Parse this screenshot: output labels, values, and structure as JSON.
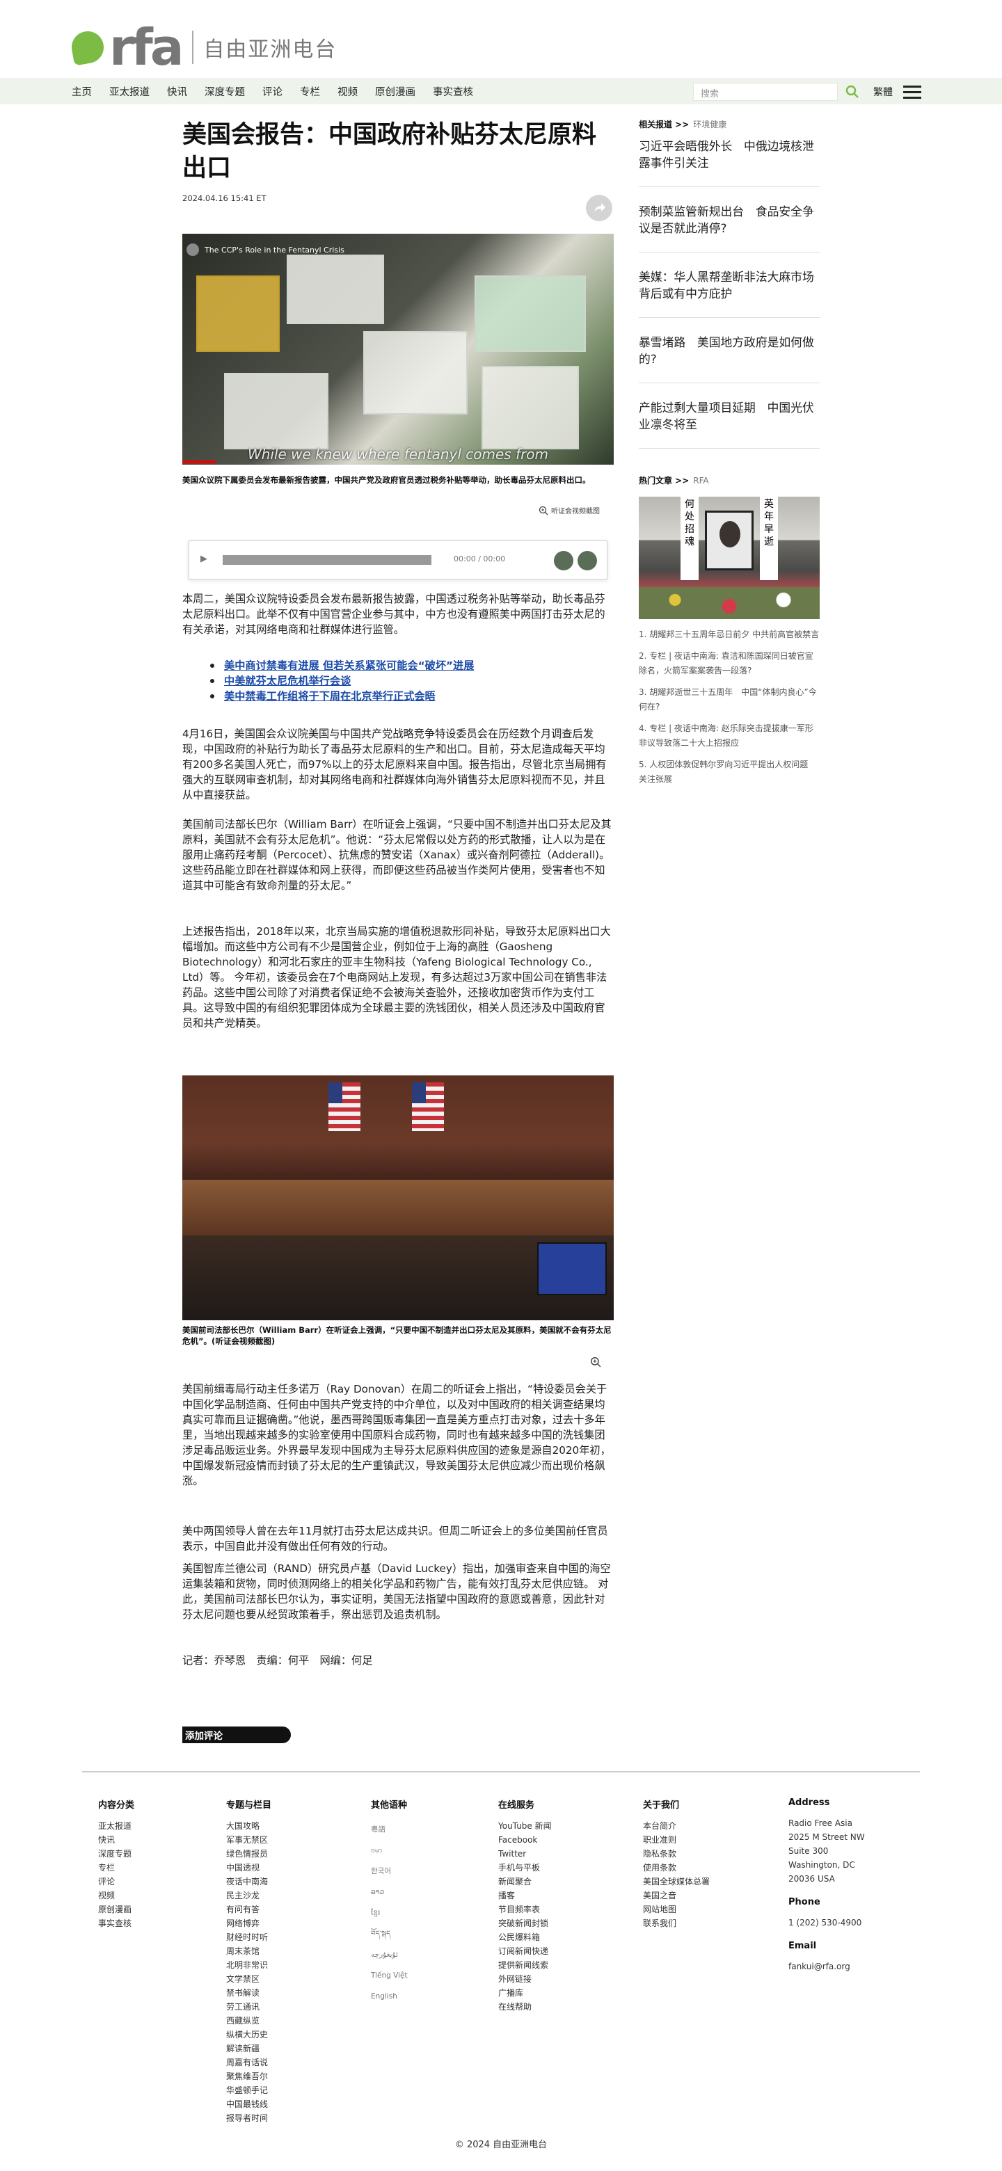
{
  "header": {
    "logo_text": "rfa",
    "logo_sub": "自由亚洲电台",
    "nav": [
      "主页",
      "亚太报道",
      "快讯",
      "深度专题",
      "评论",
      "专栏",
      "视频",
      "原创漫画",
      "事实查核"
    ],
    "search_placeholder": "搜索",
    "lang": "繁體"
  },
  "article": {
    "headline": "美国会报告：中国政府补贴芬太尼原料出口",
    "dateline": "2024.04.16 15:41 ET",
    "video_title": "The CCP's Role in the Fentanyl Crisis",
    "video_subtitle": "While we knew where fentanyl comes from",
    "caption1": "美国众议院下属委员会发布最新报告披露，中国共产党及政府官员透过税务补贴等举动，助长毒品芬太尼原料出口。",
    "enlarge_label": "听证会视频截图",
    "audio_time": "00:00 / 00:00",
    "p1": "本周二，美国众议院特设委员会发布最新报告披露，中国透过税务补贴等举动，助长毒品芬太尼原料出口。此举不仅有中国官营企业参与其中，中方也没有遵照美中两国打击芬太尼的有关承诺，对其网络电商和社群媒体进行监管。",
    "related": [
      "美中商讨禁毒有进展 但若关系紧张可能会“破坏”进展",
      "中美就芬太尼危机举行会谈",
      "美中禁毒工作组将于下周在北京举行正式会晤"
    ],
    "p2": "4月16日，美国国会众议院美国与中国共产党战略竞争特设委员会在历经数个月调查后发现，中国政府的补贴行为助长了毒品芬太尼原料的生产和出口。目前，芬太尼造成每天平均有200多名美国人死亡，而97%以上的芬太尼原料来自中国。报告指出，尽管北京当局拥有强大的互联网审查机制，却对其网络电商和社群媒体向海外销售芬太尼原料视而不见，并且从中直接获益。",
    "p3": "美国前司法部长巴尔（William Barr）在听证会上强调，“只要中国不制造并出口芬太尼及其原料，美国就不会有芬太尼危机”。他说：“芬太尼常假以处方药的形式散播，让人以为是在服用止痛药羟考酮（Percocet）、抗焦虑的赞安诺（Xanax）或兴奋剂阿德拉（Adderall)。这些药品能立即在社群媒体和网上获得，而即便这些药品被当作类阿片使用，受害者也不知道其中可能含有致命剂量的芬太尼。”",
    "p4": "上述报告指出，2018年以来，北京当局实施的增值税退款形同补贴，导致芬太尼原料出口大幅增加。而这些中方公司有不少是国营企业，例如位于上海的高胜（Gaosheng Biotechnology）和河北石家庄的亚丰生物科技（Yafeng Biological Technology Co., Ltd）等。 今年初，该委员会在7个电商网站上发现，有多达超过3万家中国公司在销售非法药品。这些中国公司除了对消费者保证绝不会被海关查验外，还接收加密货币作为支付工具。这导致中国的有组织犯罪团体成为全球最主要的洗钱团伙，相关人员还涉及中国政府官员和共产党精英。",
    "caption2": "美国前司法部长巴尔（William Barr）在听证会上强调，“只要中国不制造并出口芬太尼及其原料，美国就不会有芬太尼危机”。(听证会视频截图)",
    "p5": "美国前缉毒局行动主任多诺万（Ray Donovan）在周二的听证会上指出，“特设委员会关于中国化学品制造商、任何由中国共产党支持的中介单位，以及对中国政府的相关调查结果均真实可靠而且证据确凿。”他说，墨西哥跨国贩毒集团一直是美方重点打击对象，过去十多年里，当地出现越来越多的实验室使用中国原料合成药物，同时也有越来越多中国的洗钱集团涉足毒品贩运业务。外界最早发现中国成为主导芬太尼原料供应国的迹象是源自2020年初，中国爆发新冠疫情而封锁了芬太尼的生产重镇武汉，导致美国芬太尼供应减少而出现价格飙涨。",
    "p6": "美中两国领导人曾在去年11月就打击芬太尼达成共识。但周二听证会上的多位美国前任官员表示，中国自此并没有做出任何有效的行动。",
    "p7": "美国智库兰德公司（RAND）研究员卢基（David Luckey）指出，加强审查来自中国的海空运集装箱和货物，同时侦测网络上的相关化学品和药物广告，能有效打乱芬太尼供应链。 对此，美国前司法部长巴尔认为，事实证明，美国无法指望中国政府的意愿或善意，因此针对芬太尼问题也要从经贸政策着手，祭出惩罚及追责机制。",
    "byline": "记者：乔琴恩　责编：何平　网编：何足",
    "comment_btn": "添加评论"
  },
  "sidebar": {
    "related_head": "相关报道 >>",
    "related_sub": "环境健康",
    "related_items": [
      "习近平会晤俄外长　中俄边境核泄露事件引关注",
      "预制菜监管新规出台　食品安全争议是否就此消停?",
      "美媒：华人黑帮垄断非法大麻市场 背后或有中方庇护",
      "暴雪堵路　美国地方政府是如何做的?",
      "产能过剩大量项目延期　中国光伏业凛冬将至"
    ],
    "hot_head": "热门文章 >>",
    "hot_sub": "RFA",
    "hot_banner_left": "何处招魂",
    "hot_banner_right": "英年早逝",
    "hot_items": [
      "1. 胡耀邦三十五周年忌日前夕 中共前高官被禁言",
      "2. 专栏 | 夜话中南海: 袁洁和陈国琛同日被官宣除名，火箭军案案袭告一段落?",
      "3. 胡耀邦逝世三十五周年　中国“体制内良心”今何在?",
      "4. 专栏 | 夜话中南海: 赵乐际突击提拔康一军形非议导致落二十大上招报应",
      "5. 人权团体敦促韩尔罗向习近平提出人权问题　关注张展"
    ]
  },
  "footer": {
    "cols": [
      {
        "title": "内容分类",
        "items": [
          "亚太报道",
          "快讯",
          "深度专题",
          "专栏",
          "评论",
          "视频",
          "原创漫画",
          "事实查核"
        ]
      },
      {
        "title": "专题与栏目",
        "items": [
          "大国攻略",
          "军事无禁区",
          "绿色情报员",
          "中国透视",
          "夜话中南海",
          "民主沙龙",
          "有问有答",
          "网络博弈",
          "财经时时听",
          "周末茶馆",
          "北明非常识",
          "文学禁区",
          "禁书解读",
          "劳工通讯",
          "西藏纵览",
          "纵横大历史",
          "解读新疆",
          "周嘉有话说",
          "聚焦维吾尔",
          "华盛顿手记",
          "中国最钱线",
          "报导者时间"
        ]
      },
      {
        "title": "其他语种",
        "items": [
          "粵語",
          "ဗမာ",
          "한국어",
          "ລາວ",
          "ខ្មែរ",
          "བོད་སྐད",
          "ئۇيغۇرچە",
          "Tiếng Việt",
          "English"
        ]
      },
      {
        "title": "在线服务",
        "items": [
          "YouTube 新闻",
          "Facebook",
          "Twitter",
          "手机与平板",
          "新闻聚合",
          "播客",
          "节目频率表",
          "突破新闻封锁",
          "公民爆料箱",
          "订阅新闻快递",
          "提供新闻线索",
          "外网链接",
          "广播库",
          "在线帮助"
        ]
      },
      {
        "title": "关于我们",
        "items": [
          "本台简介",
          "职业准则",
          "隐私条款",
          "使用条款",
          "美国全球媒体总署",
          "美国之音",
          "网站地图",
          "联系我们"
        ]
      }
    ],
    "address_head": "Address",
    "address_lines": [
      "Radio Free Asia",
      "2025 M Street NW",
      "Suite 300",
      "Washington, DC",
      "20036 USA"
    ],
    "phone_head": "Phone",
    "phone": "1 (202) 530-4900",
    "email_head": "Email",
    "email": "fankui@rfa.org",
    "copyright": "© 2024 自由亚洲电台"
  },
  "colors": {
    "brand_green": "#7cbc45",
    "nav_bg": "#eef3ec",
    "link_blue": "#1a4aa8"
  }
}
